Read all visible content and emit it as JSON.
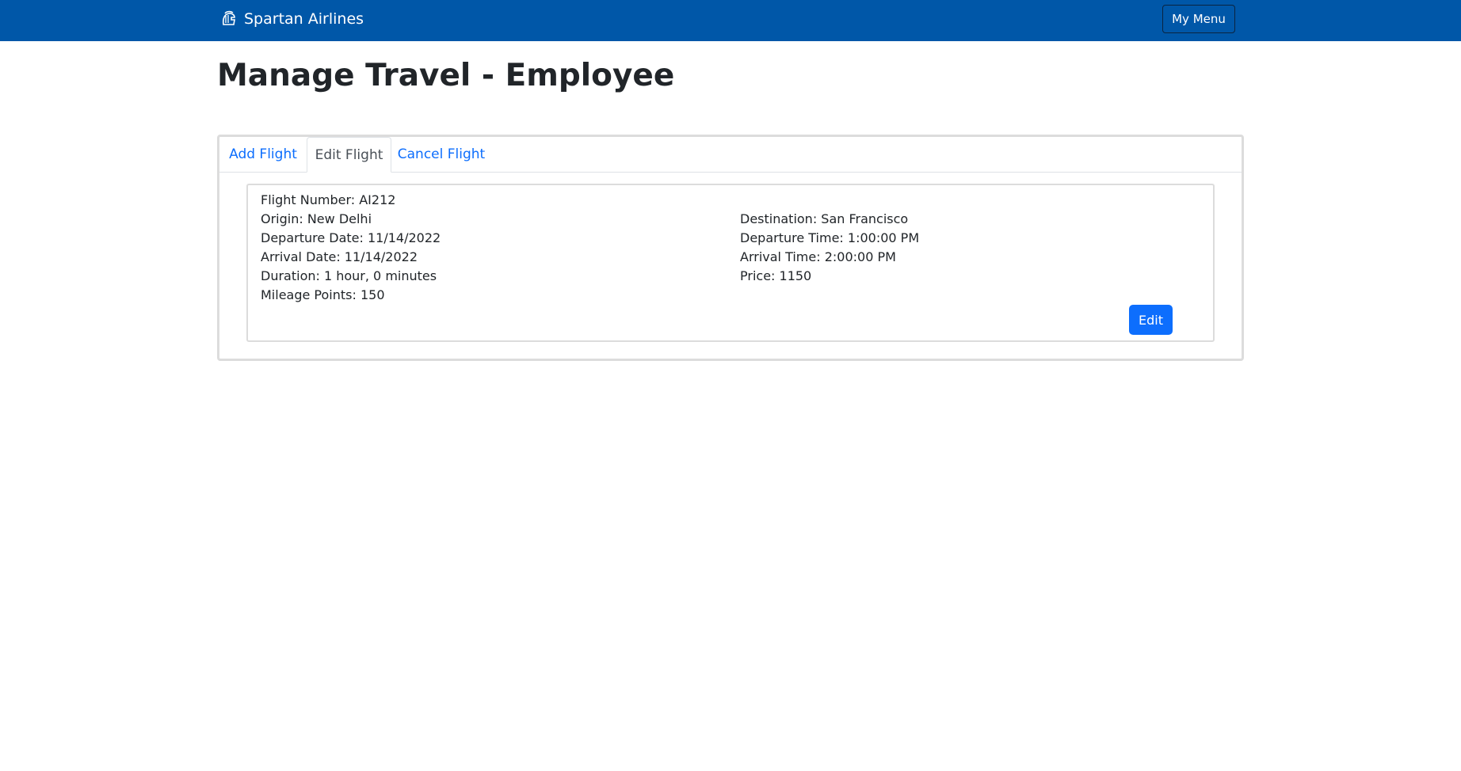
{
  "navbar": {
    "brand_label": "Spartan Airlines",
    "brand_icon": "spartan-helmet-icon",
    "menu_label": "My Menu",
    "background_color": "#0057a8"
  },
  "page": {
    "title": "Manage Travel - Employee"
  },
  "tabs": [
    {
      "label": "Add Flight",
      "active": false
    },
    {
      "label": "Edit Flight",
      "active": true
    },
    {
      "label": "Cancel Flight",
      "active": false
    }
  ],
  "flight": {
    "flight_number": "Flight Number: AI212",
    "origin": "Origin: New Delhi",
    "destination": "Destination: San Francisco",
    "departure_date": "Departure Date: 11/14/2022",
    "departure_time": "Departure Time: 1:00:00 PM",
    "arrival_date": "Arrival Date: 11/14/2022",
    "arrival_time": "Arrival Time: 2:00:00 PM",
    "duration": "Duration: 1 hour, 0 minutes",
    "price": "Price: 1150",
    "mileage_points": "Mileage Points: 150"
  },
  "actions": {
    "edit_label": "Edit",
    "accent_color": "#0d6efd"
  }
}
